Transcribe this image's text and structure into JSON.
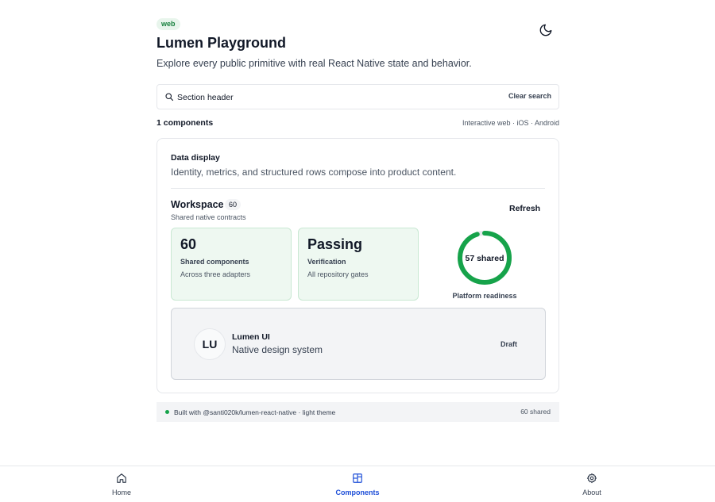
{
  "header": {
    "badge": "web",
    "title": "Lumen Playground",
    "subtitle": "Explore every public primitive with real React Native state and behavior.",
    "theme_toggle_icon": "moon-icon"
  },
  "search": {
    "value": "Section header",
    "clear_label": "Clear search"
  },
  "results": {
    "count_label": "1 components",
    "platforms": "Interactive web · iOS · Android"
  },
  "card": {
    "category": "Data display",
    "description": "Identity, metrics, and structured rows compose into product content.",
    "section": {
      "title": "Workspace",
      "count": "60",
      "subtitle": "Shared native contracts",
      "action": "Refresh"
    },
    "stats": [
      {
        "value": "60",
        "label": "Shared components",
        "note": "Across three adapters"
      },
      {
        "value": "Passing",
        "label": "Verification",
        "note": "All repository gates"
      }
    ],
    "progress": {
      "label": "57 shared",
      "caption": "Platform readiness",
      "fraction": 0.95,
      "color": "#16a34a"
    },
    "profile": {
      "initials": "LU",
      "name": "Lumen UI",
      "role": "Native design system",
      "status": "Draft"
    }
  },
  "footer": {
    "built": "Built with @santi020k/lumen-react-native · light theme",
    "shared": "60 shared"
  },
  "tabs": [
    {
      "label": "Home",
      "icon": "home-icon",
      "active": false
    },
    {
      "label": "Components",
      "icon": "components-icon",
      "active": true
    },
    {
      "label": "About",
      "icon": "gear-icon",
      "active": false
    }
  ],
  "colors": {
    "accent": "#1d4ed8",
    "success": "#16a34a",
    "success_bg": "#eef8f1"
  }
}
